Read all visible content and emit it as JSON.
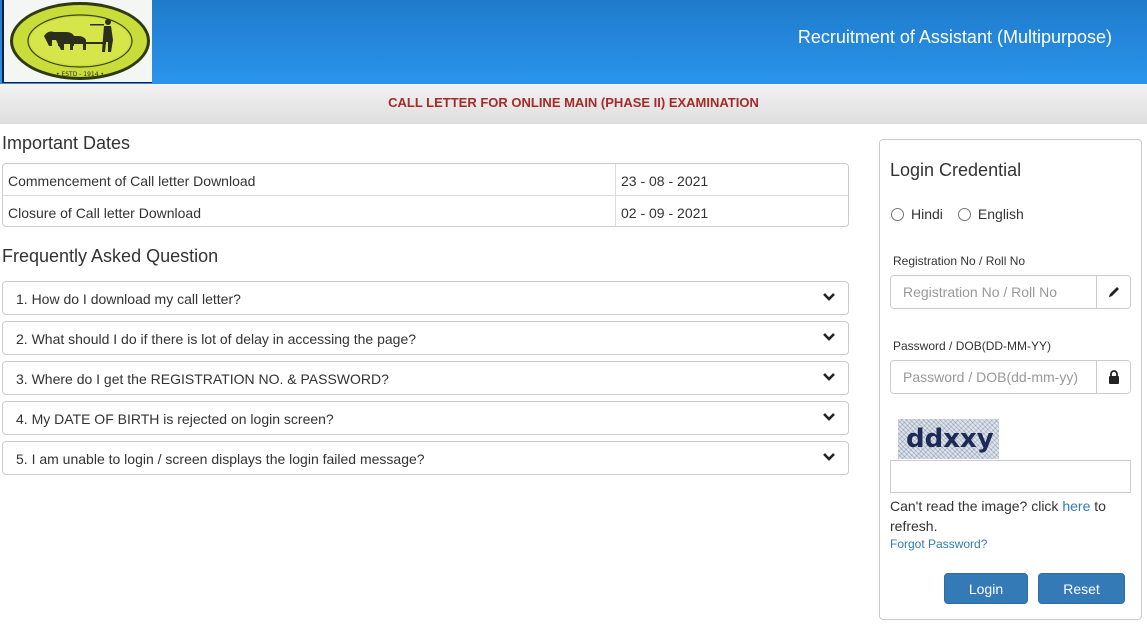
{
  "header": {
    "logo_alt": "The Bihar State Co-Operative Bank Ltd. Patna - Estd 1914",
    "title": "Recruitment of Assistant (Multipurpose)"
  },
  "subheader": {
    "title": "CALL LETTER FOR ONLINE MAIN (PHASE II) EXAMINATION"
  },
  "important_dates": {
    "heading": "Important Dates",
    "rows": [
      {
        "label": "Commencement of Call letter Download",
        "value": "23 - 08 - 2021"
      },
      {
        "label": "Closure of Call letter Download",
        "value": "02 - 09 - 2021"
      }
    ]
  },
  "faq": {
    "heading": "Frequently Asked Question",
    "items": [
      {
        "question": "1. How do I download my call letter?"
      },
      {
        "question": "2. What should I do if there is lot of delay in accessing the page?"
      },
      {
        "question": "3. Where do I get the REGISTRATION NO. & PASSWORD?"
      },
      {
        "question": "4. My DATE OF BIRTH is rejected on login screen?"
      },
      {
        "question": "5. I am unable to login / screen displays the login failed message?"
      }
    ]
  },
  "login": {
    "title": "Login Credential",
    "languages": [
      "Hindi",
      "English"
    ],
    "registration_label": "Registration No / Roll No",
    "registration_placeholder": "Registration No / Roll No",
    "registration_icon": "pencil-icon",
    "password_label": "Password / DOB(DD-MM-YY)",
    "password_placeholder": "Password / DOB(dd-mm-yy)",
    "password_icon": "lock-icon",
    "captcha_text": "ddxxy",
    "captcha_value": "",
    "refresh_prefix": "Can't read the image? click ",
    "refresh_link": "here",
    "refresh_suffix": " to refresh.",
    "forgot_password": "Forgot Password?",
    "login_button": "Login",
    "reset_button": "Reset"
  },
  "colors": {
    "header_blue": "#2a94ec",
    "subheader_red": "#a52a2a",
    "button_blue": "#337ab7"
  }
}
